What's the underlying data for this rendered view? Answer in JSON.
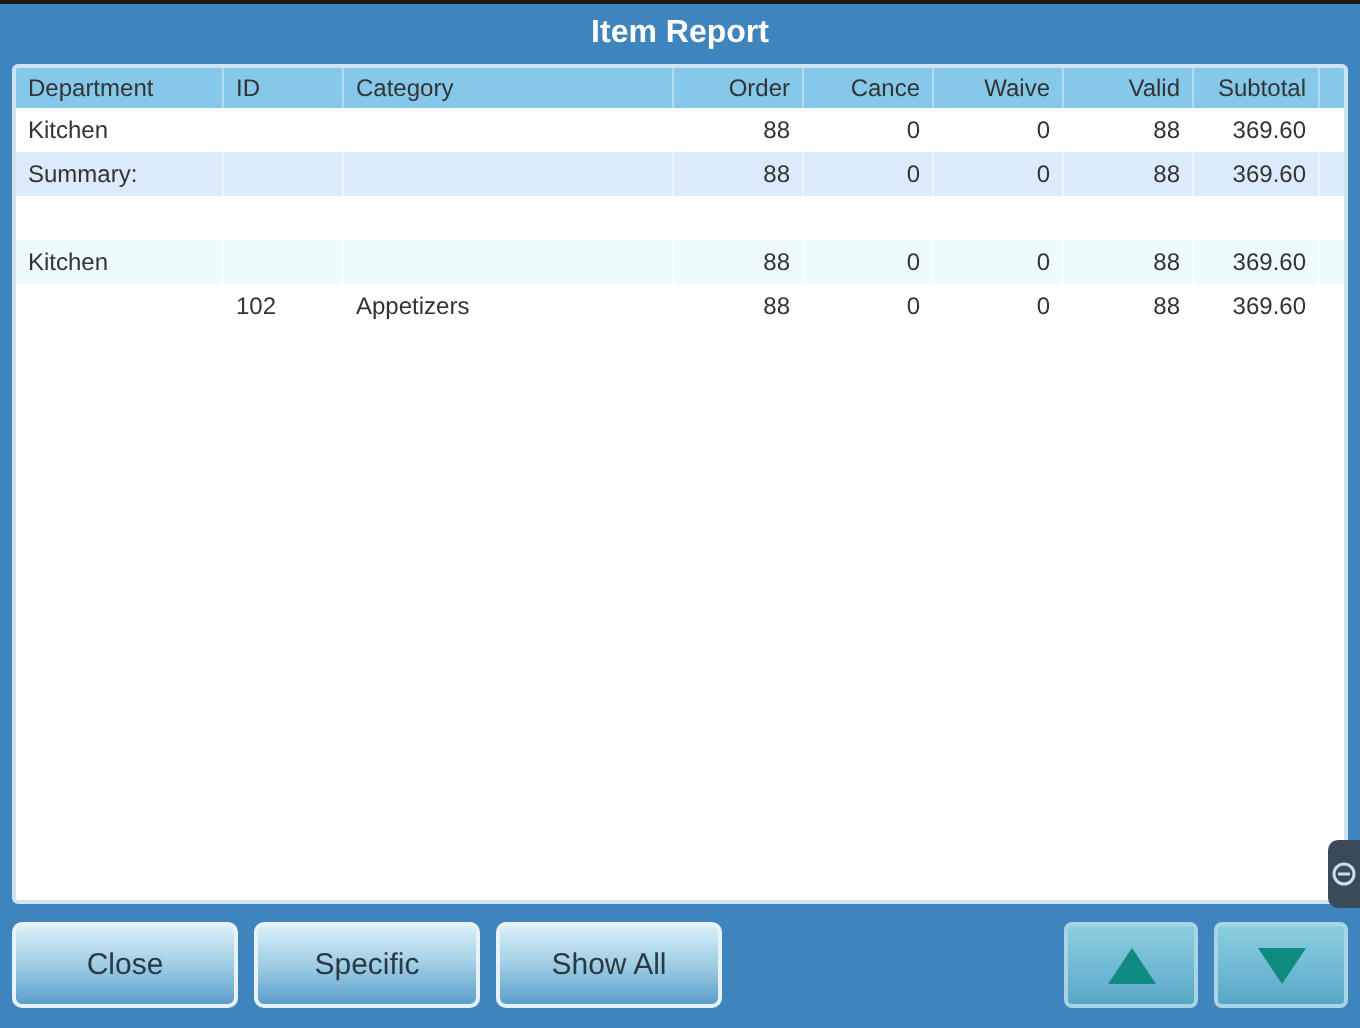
{
  "window": {
    "title": "Item Report"
  },
  "table": {
    "columns": [
      {
        "label": "Department",
        "kind": "text"
      },
      {
        "label": "ID",
        "kind": "text"
      },
      {
        "label": "Category",
        "kind": "text"
      },
      {
        "label": "Order",
        "kind": "number"
      },
      {
        "label": "Cance",
        "kind": "number"
      },
      {
        "label": "Waive",
        "kind": "number"
      },
      {
        "label": "Valid",
        "kind": "number"
      },
      {
        "label": "Subtotal",
        "kind": "number"
      }
    ],
    "groups": [
      {
        "rows": [
          {
            "kind": "plain",
            "cells": [
              "Kitchen",
              "",
              "",
              "88",
              "0",
              "0",
              "88",
              "369.60"
            ]
          },
          {
            "kind": "summary",
            "cells": [
              "Summary:",
              "",
              "",
              "88",
              "0",
              "0",
              "88",
              "369.60"
            ]
          }
        ]
      },
      {
        "rows": [
          {
            "kind": "highlight",
            "cells": [
              "Kitchen",
              "",
              "",
              "88",
              "0",
              "0",
              "88",
              "369.60"
            ]
          },
          {
            "kind": "plain",
            "cells": [
              "",
              "102",
              "Appetizers",
              "88",
              "0",
              "0",
              "88",
              "369.60"
            ]
          }
        ]
      }
    ]
  },
  "buttons": [
    {
      "kind": "text",
      "label": "Close"
    },
    {
      "kind": "text",
      "label": "Specific"
    },
    {
      "kind": "text",
      "label": "Show All"
    },
    {
      "kind": "up"
    },
    {
      "kind": "down"
    }
  ]
}
